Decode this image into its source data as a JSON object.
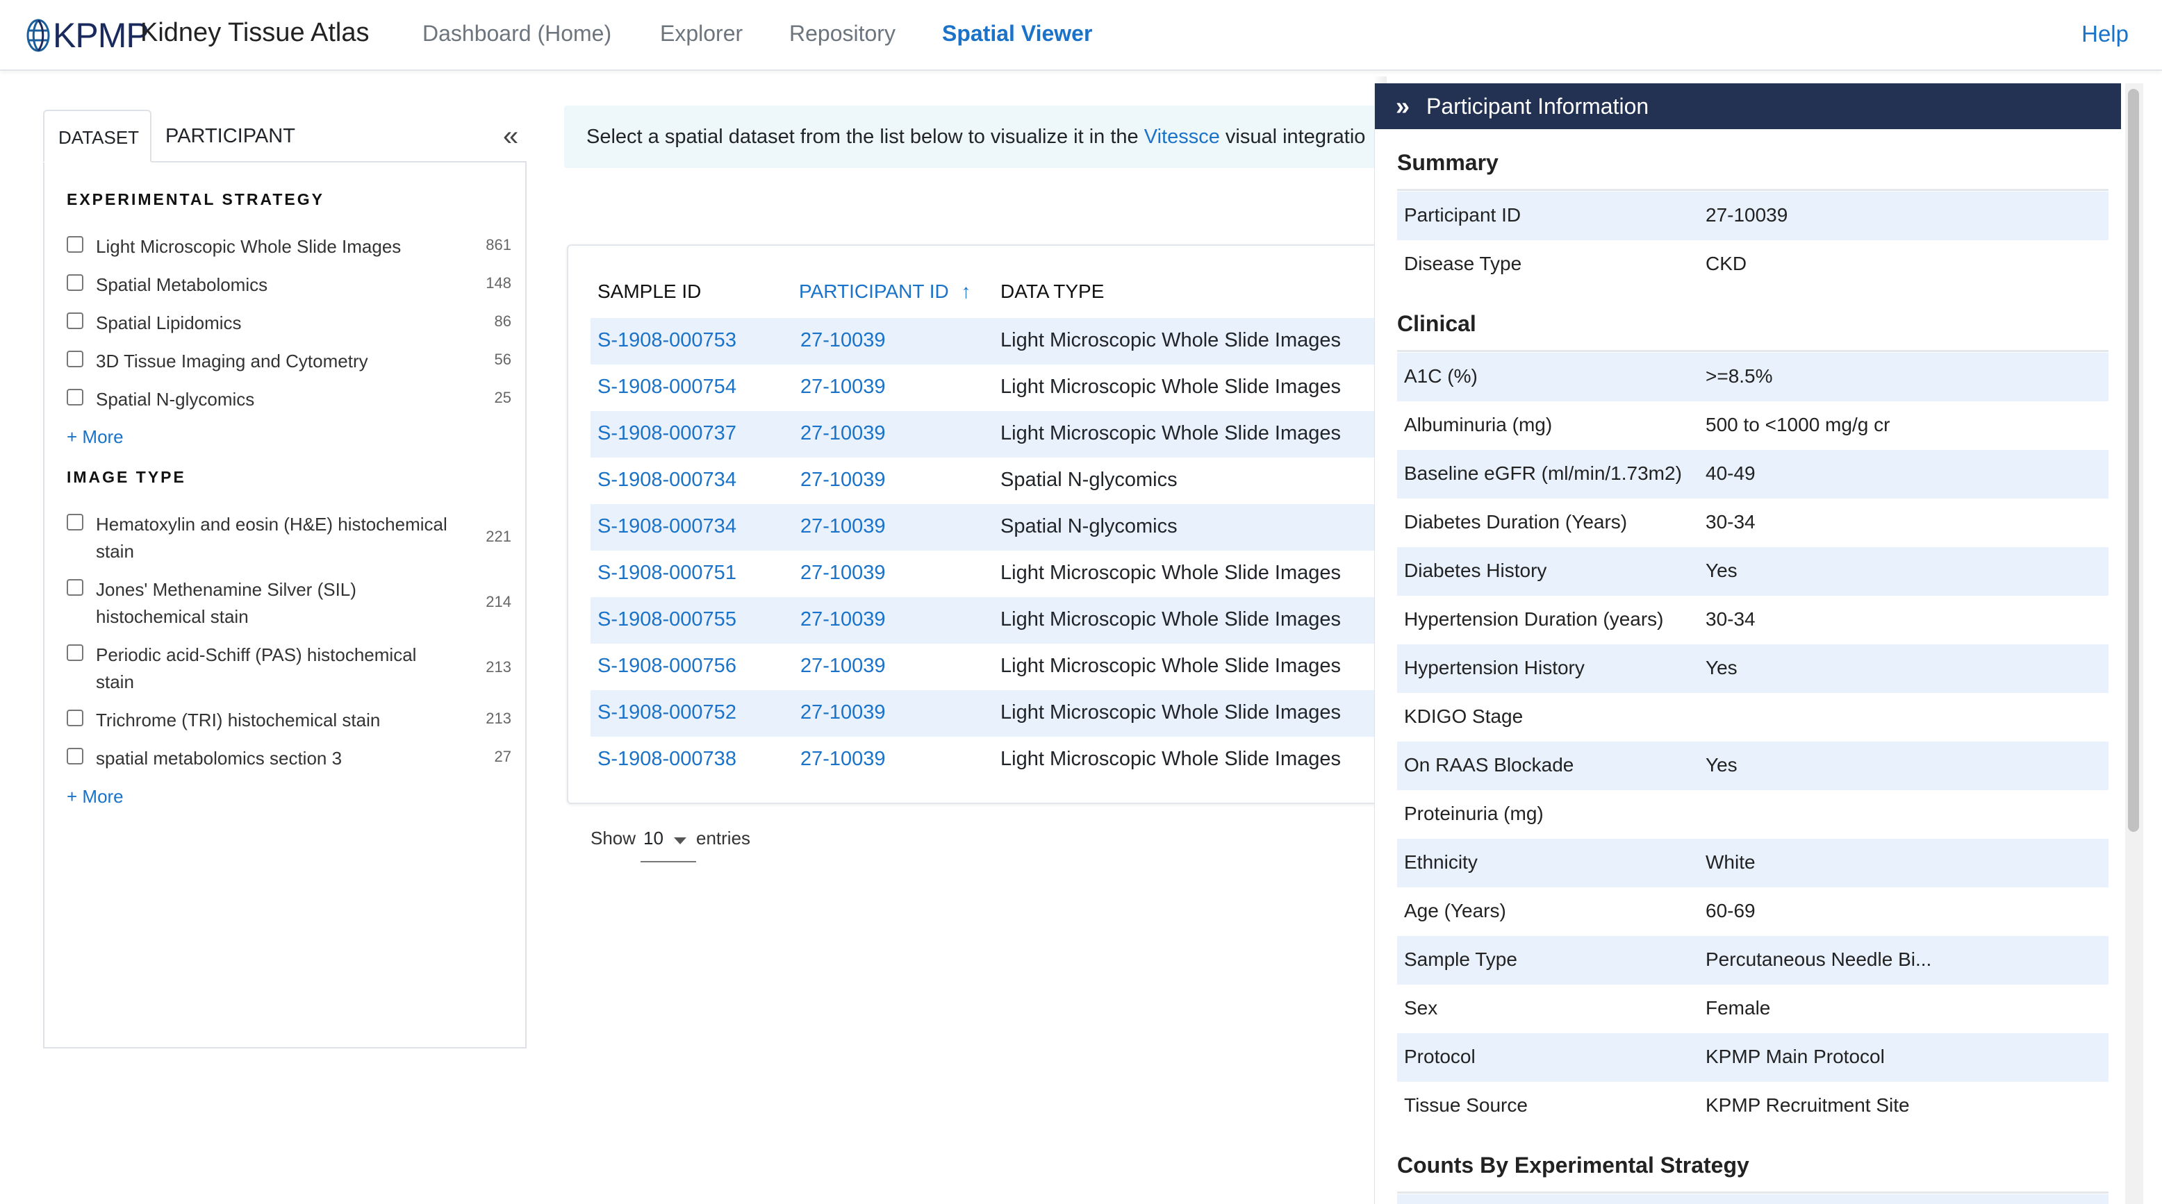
{
  "navbar": {
    "logo_text": "KPMP",
    "app_title": "Kidney Tissue Atlas",
    "items": [
      {
        "label": "Dashboard (Home)",
        "active": false
      },
      {
        "label": "Explorer",
        "active": false
      },
      {
        "label": "Repository",
        "active": false
      },
      {
        "label": "Spatial Viewer",
        "active": true
      }
    ],
    "help": "Help"
  },
  "filter": {
    "tabs": [
      "DATASET",
      "PARTICIPANT"
    ],
    "sections": [
      {
        "title": "EXPERIMENTAL STRATEGY",
        "items": [
          {
            "label": "Light Microscopic Whole Slide Images",
            "count": "861"
          },
          {
            "label": "Spatial Metabolomics",
            "count": "148"
          },
          {
            "label": "Spatial Lipidomics",
            "count": "86"
          },
          {
            "label": "3D Tissue Imaging and Cytometry",
            "count": "56"
          },
          {
            "label": "Spatial N-glycomics",
            "count": "25"
          }
        ],
        "more": "+ More"
      },
      {
        "title": "IMAGE TYPE",
        "items": [
          {
            "label": "Hematoxylin and eosin (H&E) histochemical stain",
            "count": "221"
          },
          {
            "label": "Jones' Methenamine Silver (SIL) histochemical stain",
            "count": "214"
          },
          {
            "label": "Periodic acid-Schiff (PAS) histochemical stain",
            "count": "213"
          },
          {
            "label": "Trichrome (TRI) histochemical stain",
            "count": "213"
          },
          {
            "label": "spatial metabolomics section 3",
            "count": "27"
          }
        ],
        "more": "+ More"
      }
    ]
  },
  "banner": {
    "prefix": "Select a spatial dataset from the list below to visualize it in the ",
    "link": "Vitessce",
    "suffix": " visual integratio"
  },
  "table": {
    "headers": [
      "SAMPLE ID",
      "PARTICIPANT ID",
      "DATA TYPE"
    ],
    "sort_icon": "↑",
    "rows": [
      {
        "sample": "S-1908-000753",
        "participant": "27-10039",
        "type": "Light Microscopic Whole Slide Images"
      },
      {
        "sample": "S-1908-000754",
        "participant": "27-10039",
        "type": "Light Microscopic Whole Slide Images"
      },
      {
        "sample": "S-1908-000737",
        "participant": "27-10039",
        "type": "Light Microscopic Whole Slide Images"
      },
      {
        "sample": "S-1908-000734",
        "participant": "27-10039",
        "type": "Spatial N-glycomics"
      },
      {
        "sample": "S-1908-000734",
        "participant": "27-10039",
        "type": "Spatial N-glycomics"
      },
      {
        "sample": "S-1908-000751",
        "participant": "27-10039",
        "type": "Light Microscopic Whole Slide Images"
      },
      {
        "sample": "S-1908-000755",
        "participant": "27-10039",
        "type": "Light Microscopic Whole Slide Images"
      },
      {
        "sample": "S-1908-000756",
        "participant": "27-10039",
        "type": "Light Microscopic Whole Slide Images"
      },
      {
        "sample": "S-1908-000752",
        "participant": "27-10039",
        "type": "Light Microscopic Whole Slide Images"
      },
      {
        "sample": "S-1908-000738",
        "participant": "27-10039",
        "type": "Light Microscopic Whole Slide Images"
      }
    ],
    "pagination": {
      "show": "Show",
      "value": "10",
      "entries": "entries"
    }
  },
  "participant_panel": {
    "title": "Participant Information",
    "summary": {
      "title": "Summary",
      "rows": [
        {
          "key": "Participant ID",
          "value": "27-10039"
        },
        {
          "key": "Disease Type",
          "value": "CKD"
        }
      ]
    },
    "clinical": {
      "title": "Clinical",
      "rows": [
        {
          "key": "A1C (%)",
          "value": ">=8.5%"
        },
        {
          "key": "Albuminuria (mg)",
          "value": "500 to <1000 mg/g cr"
        },
        {
          "key": "Baseline eGFR (ml/min/1.73m2)",
          "value": "40-49"
        },
        {
          "key": "Diabetes Duration (Years)",
          "value": "30-34"
        },
        {
          "key": "Diabetes History",
          "value": "Yes"
        },
        {
          "key": "Hypertension Duration (years)",
          "value": "30-34"
        },
        {
          "key": "Hypertension History",
          "value": "Yes"
        },
        {
          "key": "KDIGO Stage",
          "value": ""
        },
        {
          "key": "On RAAS Blockade",
          "value": "Yes"
        },
        {
          "key": "Proteinuria (mg)",
          "value": ""
        },
        {
          "key": "Ethnicity",
          "value": "White"
        },
        {
          "key": "Age (Years)",
          "value": "60-69"
        },
        {
          "key": "Sample Type",
          "value": "Percutaneous Needle Bi..."
        },
        {
          "key": "Sex",
          "value": "Female"
        },
        {
          "key": "Protocol",
          "value": "KPMP Main Protocol"
        },
        {
          "key": "Tissue Source",
          "value": "KPMP Recruitment Site"
        }
      ]
    },
    "counts": {
      "title": "Counts By Experimental Strategy"
    }
  },
  "colors": {
    "accent": "#1a73c8",
    "panel_header": "#233253",
    "row_stripe": "#e8f1fc",
    "banner_bg": "#eef7fa"
  }
}
